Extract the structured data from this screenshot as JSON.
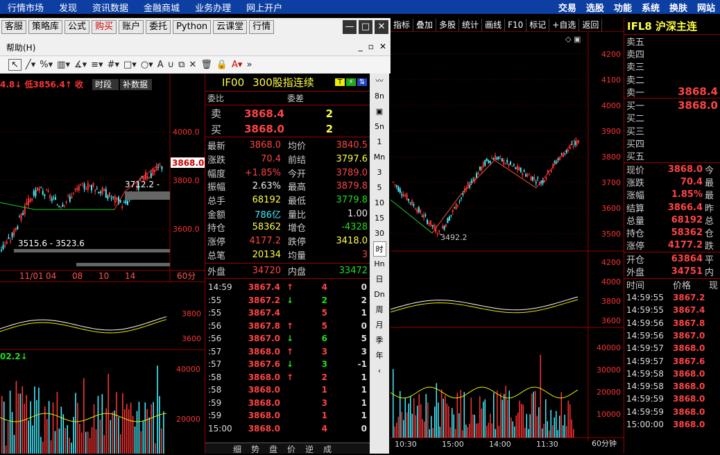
{
  "top_menu": [
    "行情市场",
    "发现",
    "资讯数据",
    "金融商城",
    "业务办理",
    "网上开户"
  ],
  "top_right": [
    "交易",
    "选股",
    "功能",
    "系统",
    "换肤",
    "网站"
  ],
  "right_toolbar": [
    "指标",
    "叠加",
    "多股",
    "统计",
    "画线",
    "F10",
    "标记",
    "+自选",
    "返回"
  ],
  "quote": {
    "title": "IFL8 沪深主连",
    "asks": [
      [
        "卖五",
        ""
      ],
      [
        "卖四",
        ""
      ],
      [
        "卖三",
        ""
      ],
      [
        "卖二",
        ""
      ],
      [
        "卖一",
        "3868.4"
      ]
    ],
    "bids": [
      [
        "买一",
        "3868.0"
      ],
      [
        "买二",
        ""
      ],
      [
        "买三",
        ""
      ],
      [
        "买四",
        ""
      ],
      [
        "买五",
        ""
      ]
    ],
    "stats": [
      [
        "现价",
        "3868.0",
        "今"
      ],
      [
        "涨跌",
        "70.4",
        "最"
      ],
      [
        "涨幅",
        "1.85%",
        "最"
      ],
      [
        "结算",
        "3866.4",
        "昨"
      ],
      [
        "总量",
        "68192",
        "总"
      ],
      [
        "持仓",
        "58362",
        "仓"
      ],
      [
        "涨停",
        "4177.2",
        "跌"
      ]
    ],
    "stats2": [
      [
        "开仓",
        "63864",
        "平"
      ],
      [
        "外盘",
        "34751",
        "内"
      ]
    ],
    "trade_header": [
      "时间",
      "价格",
      "现"
    ],
    "trades": [
      [
        "14:59:55",
        "3867.2"
      ],
      [
        "14:59:55",
        "3867.4"
      ],
      [
        "14:59:56",
        "3867.8"
      ],
      [
        "14:59:56",
        "3867.0"
      ],
      [
        "14:59:57",
        "3868.0"
      ],
      [
        "14:59:57",
        "3867.6"
      ],
      [
        "14:59:58",
        "3868.0"
      ],
      [
        "14:59:58",
        "3868.0"
      ],
      [
        "14:59:59",
        "3868.0"
      ],
      [
        "14:59:59",
        "3868.0"
      ],
      [
        "15:00:00",
        "3868.0"
      ]
    ]
  },
  "right_chart": {
    "price_ticks": [
      "4200",
      "4100",
      "4000",
      "3900",
      "3800",
      "3700",
      "3600",
      "3500"
    ],
    "low_label": "3492.2",
    "macd_ticks": [
      "4200",
      "4000",
      "3800",
      "3600"
    ],
    "vol_ticks": [
      "40000",
      "30000",
      "20000",
      "10000"
    ],
    "time_ticks": [
      "10:30",
      "15:00",
      "14:00",
      "11:30"
    ],
    "period": "60分钟"
  },
  "dialog": {
    "buttons": [
      "客服",
      "策略库",
      "公式",
      "购买",
      "账户",
      "委托",
      "Python",
      "云课堂",
      "行情"
    ],
    "win_controls": [
      "—",
      "□",
      "✕"
    ],
    "help_menu": "帮助(H)",
    "menu_ctl": [
      "_",
      "▫",
      "✕"
    ]
  },
  "left_chart": {
    "header_left": "4.8↓ 低3856.4↑ 收",
    "tag1": "时段",
    "tag2": "补数据",
    "price_ticks": [
      "4000.0",
      "3800.0",
      "3600.0"
    ],
    "last_price": "3868.0",
    "range1": "3712.2 -",
    "range2": "3515.6 - 3523.6",
    "time_ticks": [
      "11/01",
      "04",
      "08",
      "10",
      "14"
    ],
    "period": "60分",
    "macd_ticks": [
      "3800",
      "3600"
    ],
    "vol_label": "02.2↓",
    "vol_ticks": [
      "40000",
      "20000"
    ]
  },
  "detail": {
    "code": "IF00",
    "name": "300股指连续",
    "hdr": [
      "委比",
      "委差"
    ],
    "sell": {
      "label": "卖",
      "price": "3868.4",
      "vol": "2"
    },
    "buy": {
      "label": "买",
      "price": "3868.0",
      "vol": "2"
    },
    "rows": [
      [
        "最新",
        "3868.0",
        "均价",
        "3840.5"
      ],
      [
        "涨跌",
        "70.4",
        "前结",
        "3797.6"
      ],
      [
        "幅度",
        "+1.85%",
        "今开",
        "3789.0"
      ],
      [
        "振幅",
        "2.63%",
        "最高",
        "3879.8"
      ],
      [
        "总手",
        "68192",
        "最低",
        "3779.8"
      ],
      [
        "金额",
        "786亿",
        "量比",
        "1.00"
      ],
      [
        "持仓",
        "58362",
        "增仓",
        "-4328"
      ],
      [
        "涨停",
        "4177.2",
        "跌停",
        "3418.0"
      ],
      [
        "总笔",
        "20134",
        "均量",
        "3"
      ]
    ],
    "outer": [
      "外盘",
      "34720",
      "内盘",
      "33472"
    ],
    "ticks": [
      [
        "14:59",
        "3867.4",
        "↑",
        "4",
        "0"
      ],
      [
        ":55",
        "3867.2",
        "↓",
        "2",
        "2"
      ],
      [
        ":55",
        "3867.4",
        "",
        "5",
        "1"
      ],
      [
        ":56",
        "3867.8",
        "↑",
        "5",
        "0"
      ],
      [
        ":56",
        "3867.0",
        "↓",
        "6",
        "5"
      ],
      [
        ":57",
        "3868.0",
        "↑",
        "3",
        "3"
      ],
      [
        ":57",
        "3867.6",
        "↓",
        "3",
        "-1"
      ],
      [
        ":58",
        "3868.0",
        "↑",
        "2",
        "1"
      ],
      [
        ":58",
        "3868.0",
        "",
        "1",
        "1"
      ],
      [
        ":59",
        "3868.0",
        "",
        "3",
        "1"
      ],
      [
        ":59",
        "3868.0",
        "",
        "1",
        "1"
      ],
      [
        "15:00",
        "3868.0",
        "",
        "4",
        "0"
      ]
    ],
    "tabs": [
      "细",
      "势",
      "盘",
      "价",
      "逆",
      "成"
    ]
  },
  "vtool": [
    "〰",
    "8n",
    "▣",
    "5n",
    "1",
    "Mn",
    "3",
    "5",
    "10",
    "15",
    "30",
    "时",
    "Hn",
    "日",
    "Dn",
    "周",
    "月",
    "季",
    "年",
    "‹"
  ]
}
